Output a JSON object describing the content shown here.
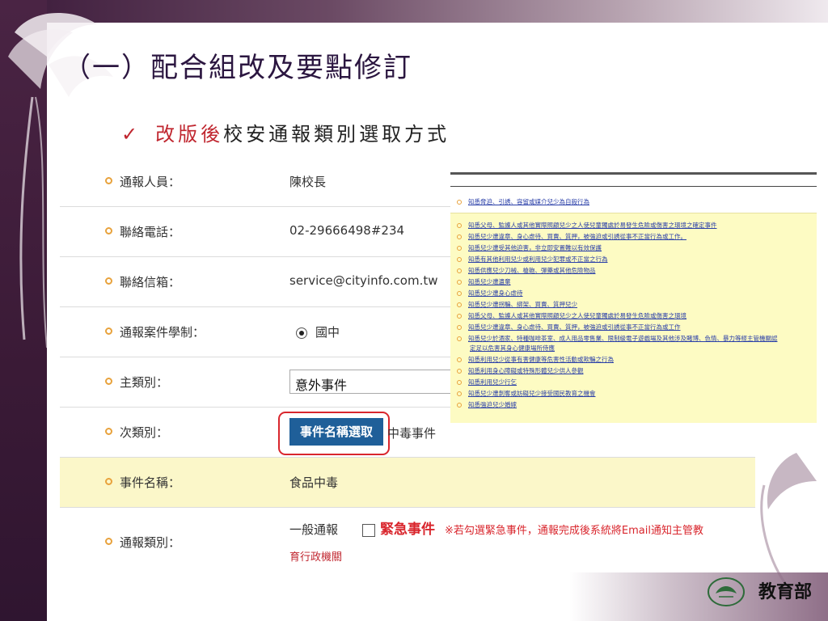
{
  "slide": {
    "title": "（一）配合組改及要點修訂",
    "bullet_check": "✓",
    "bullet_red": "改版後",
    "bullet_rest": "校安通報類別選取方式"
  },
  "form": {
    "rows": [
      {
        "label": "通報人員：",
        "value": "陳校長"
      },
      {
        "label": "聯絡電話：",
        "value": "02-29666498#234"
      },
      {
        "label": "聯絡信箱：",
        "value": "service@cityinfo.com.tw"
      },
      {
        "label": "通報案件學制：",
        "value": "國中"
      },
      {
        "label": "主類別：",
        "value": "意外事件"
      },
      {
        "label": "次類別：",
        "value": "中毒事件"
      },
      {
        "label": "事件名稱：",
        "value": "食品中毒"
      },
      {
        "label": "通報類別：",
        "value": "一般通報"
      }
    ],
    "pick_button": "事件名稱選取",
    "urgent_label": "緊急事件",
    "urgent_note": "※若勾選緊急事件，通報完成後系統將Email通知主管教",
    "urgent_note2": "育行政機關"
  },
  "popup": {
    "first_item": "知悉脅迫、引誘、容留或媒介兒少為自殺行為",
    "items": [
      "知悉父母、監護人或其他實際照顧兒少之人使兒童獨處於易發生危險或傷害之環境之確定事件",
      "知悉兒少遭違章、身心虐待、買賣、質押，被強迫或引誘從事不正當行為或工作。",
      "知悉兒少遭受其他迫害，非立即安置難以有效保護",
      "知悉有其他利用兒少或利用兒少犯罪或不正當之行為",
      "知悉供應兒少刀械、槍砲、彈藥或其他危險物品",
      "知悉兒少遭遺棄",
      "知悉兒少遭身心虐待",
      "知悉兒少遭拐騙、綁架、買賣、質押兒少",
      "知悉父母、監護人或其他實際照顧兒少之人使兒童獨處於易發生危險或傷害之環境",
      "知悉兒少遭違章、身心虐待、買賣、質押，被強迫或引誘從事不正當行為或工作",
      "知悉兒少於酒家、特種咖啡茶室、成人用品零售業、限制級電子遊戲場及其他涉及賭博、色情、暴力等經主管機關認",
      "定足以危害其身心健康場所侍應",
      "知悉利用兒少從事有害健康等危害性活動或欺騙之行為",
      "知悉利用身心障礙或特殊形體兒少供人參觀",
      "知悉利用兒少行乞",
      "知悉兒少遭剝奪或妨礙兒少接受國民教育之機會",
      "知悉強迫兒少婚嫁"
    ]
  },
  "brand": {
    "ministry": "教育部"
  }
}
